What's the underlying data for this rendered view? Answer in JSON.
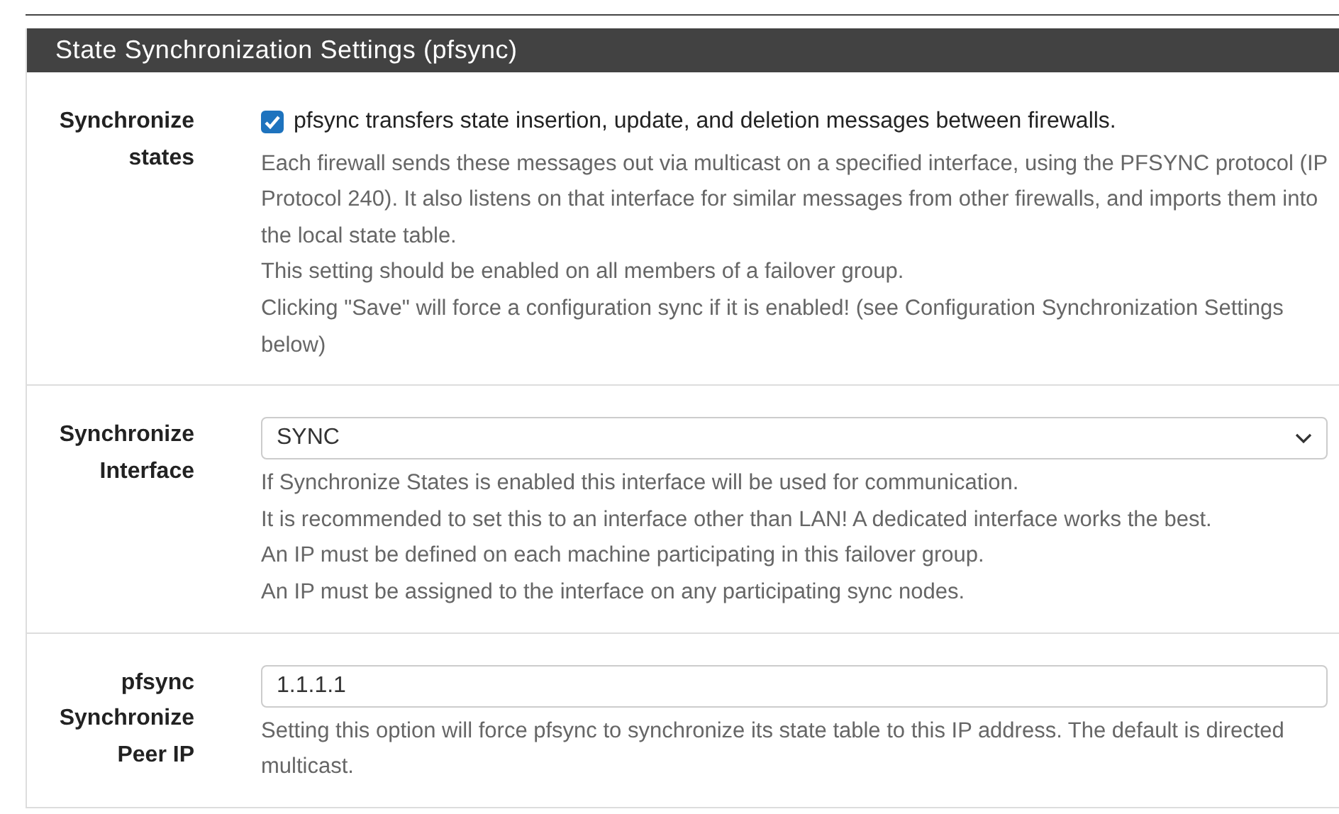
{
  "section": {
    "title": "State Synchronization Settings (pfsync)"
  },
  "rows": [
    {
      "kind": "checkbox",
      "label": "Synchronize states",
      "checked": true,
      "text": "pfsync transfers state insertion, update, and deletion messages between firewalls.",
      "help": [
        "Each firewall sends these messages out via multicast on a specified interface, using the PFSYNC protocol (IP Protocol 240). It also listens on that interface for similar messages from other firewalls, and imports them into the local state table.",
        "This setting should be enabled on all members of a failover group.",
        "Clicking \"Save\" will force a configuration sync if it is enabled! (see Configuration Synchronization Settings below)"
      ]
    },
    {
      "kind": "select",
      "label": "Synchronize Interface",
      "value": "SYNC",
      "help": [
        "If Synchronize States is enabled this interface will be used for communication.",
        "It is recommended to set this to an interface other than LAN! A dedicated interface works the best.",
        "An IP must be defined on each machine participating in this failover group.",
        "An IP must be assigned to the interface on any participating sync nodes."
      ]
    },
    {
      "kind": "input",
      "label": "pfsync Synchronize Peer IP",
      "value": "1.1.1.1",
      "help": [
        "Setting this option will force pfsync to synchronize its state table to this IP address. The default is directed multicast."
      ]
    }
  ]
}
